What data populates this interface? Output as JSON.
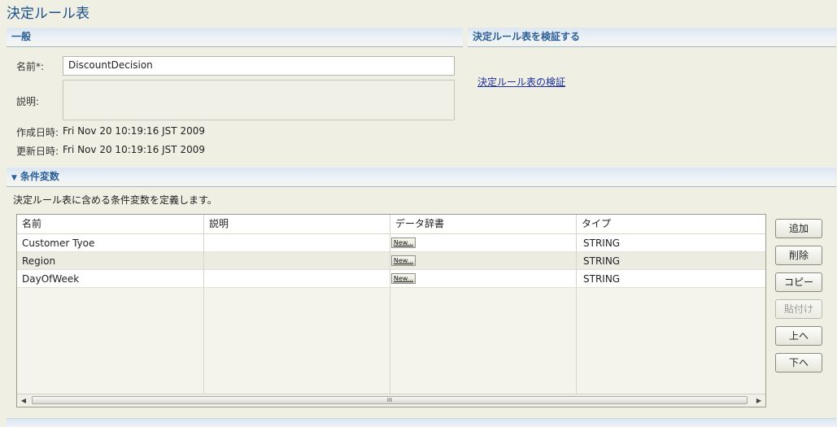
{
  "page_title": "決定ルール表",
  "general": {
    "header": "一般",
    "name_label": "名前*:",
    "name_value": "DiscountDecision",
    "desc_label": "説明:",
    "created_label": "作成日時:",
    "created_value": "Fri Nov 20 10:19:16 JST 2009",
    "updated_label": "更新日時:",
    "updated_value": "Fri Nov 20 10:19:16 JST 2009"
  },
  "validate": {
    "header": "決定ルール表を検証する",
    "link": "決定ルール表の検証"
  },
  "conditions": {
    "header": "条件変数",
    "description": "決定ルール表に含める条件変数を定義します。",
    "columns": [
      "名前",
      "説明",
      "データ辞書",
      "タイプ"
    ],
    "rows": [
      {
        "name": "Customer Tyoe",
        "description": "",
        "dictionary_button": "New...",
        "type": "STRING"
      },
      {
        "name": "Region",
        "description": "",
        "dictionary_button": "New...",
        "type": "STRING"
      },
      {
        "name": "DayOfWeek",
        "description": "",
        "dictionary_button": "New...",
        "type": "STRING"
      }
    ],
    "scroll_thumb": "III",
    "buttons": {
      "add": "追加",
      "delete": "削除",
      "copy": "コピー",
      "paste": "貼付け",
      "up": "上へ",
      "down": "下へ"
    }
  },
  "colors": {
    "accent": "#2c5f96",
    "background": "#efefe4",
    "link": "#1c2f9c"
  }
}
